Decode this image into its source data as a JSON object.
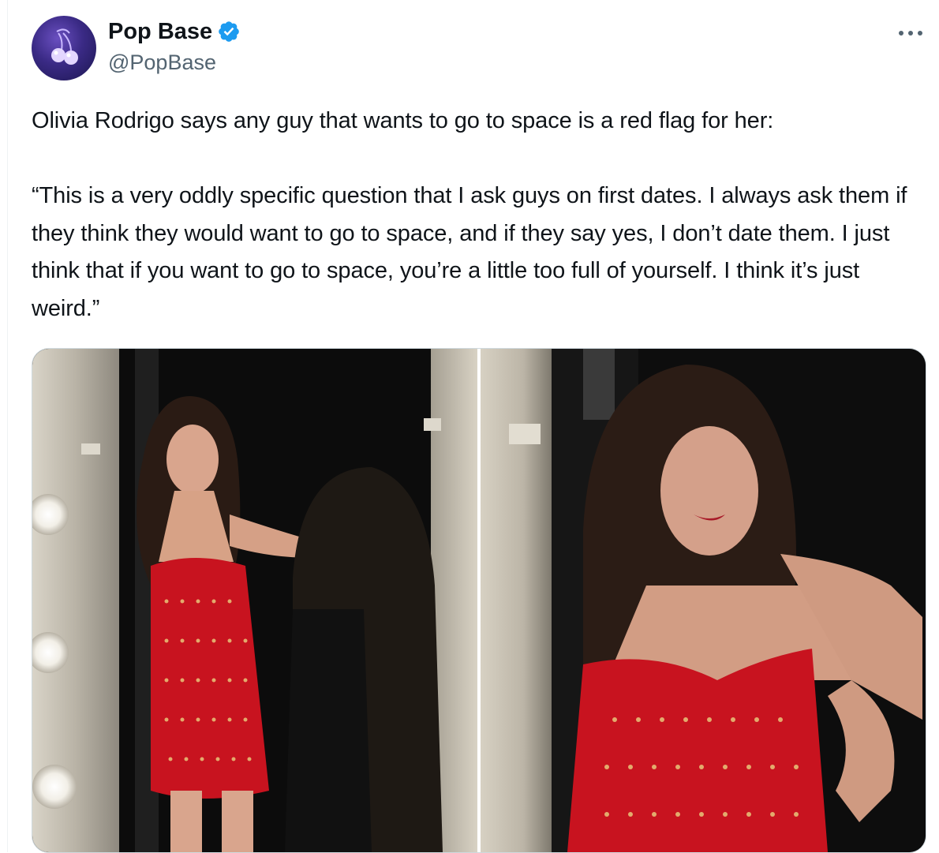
{
  "tweet": {
    "author": {
      "display_name": "Pop Base",
      "handle": "@PopBase",
      "verified": true,
      "avatar_icon": "cherry-icon"
    },
    "text": "Olivia Rodrigo says any guy that wants to go to space is a red flag for her:\n\n“This is a very oddly specific question that I ask guys on first dates. I always ask them if they think they would want to go to space, and if they say yes, I don’t date them. I just think that if you want to go to space, you’re a little too full of yourself. I think it’s just weird.”",
    "media": [
      {
        "icon": "photo-dressing-room-full-length"
      },
      {
        "icon": "photo-dressing-room-closeup"
      }
    ]
  },
  "colors": {
    "verified_blue": "#1d9bf0",
    "handle_gray": "#536471",
    "text": "#0f1419",
    "border": "#cfd9de",
    "dress_red": "#c8131f"
  }
}
